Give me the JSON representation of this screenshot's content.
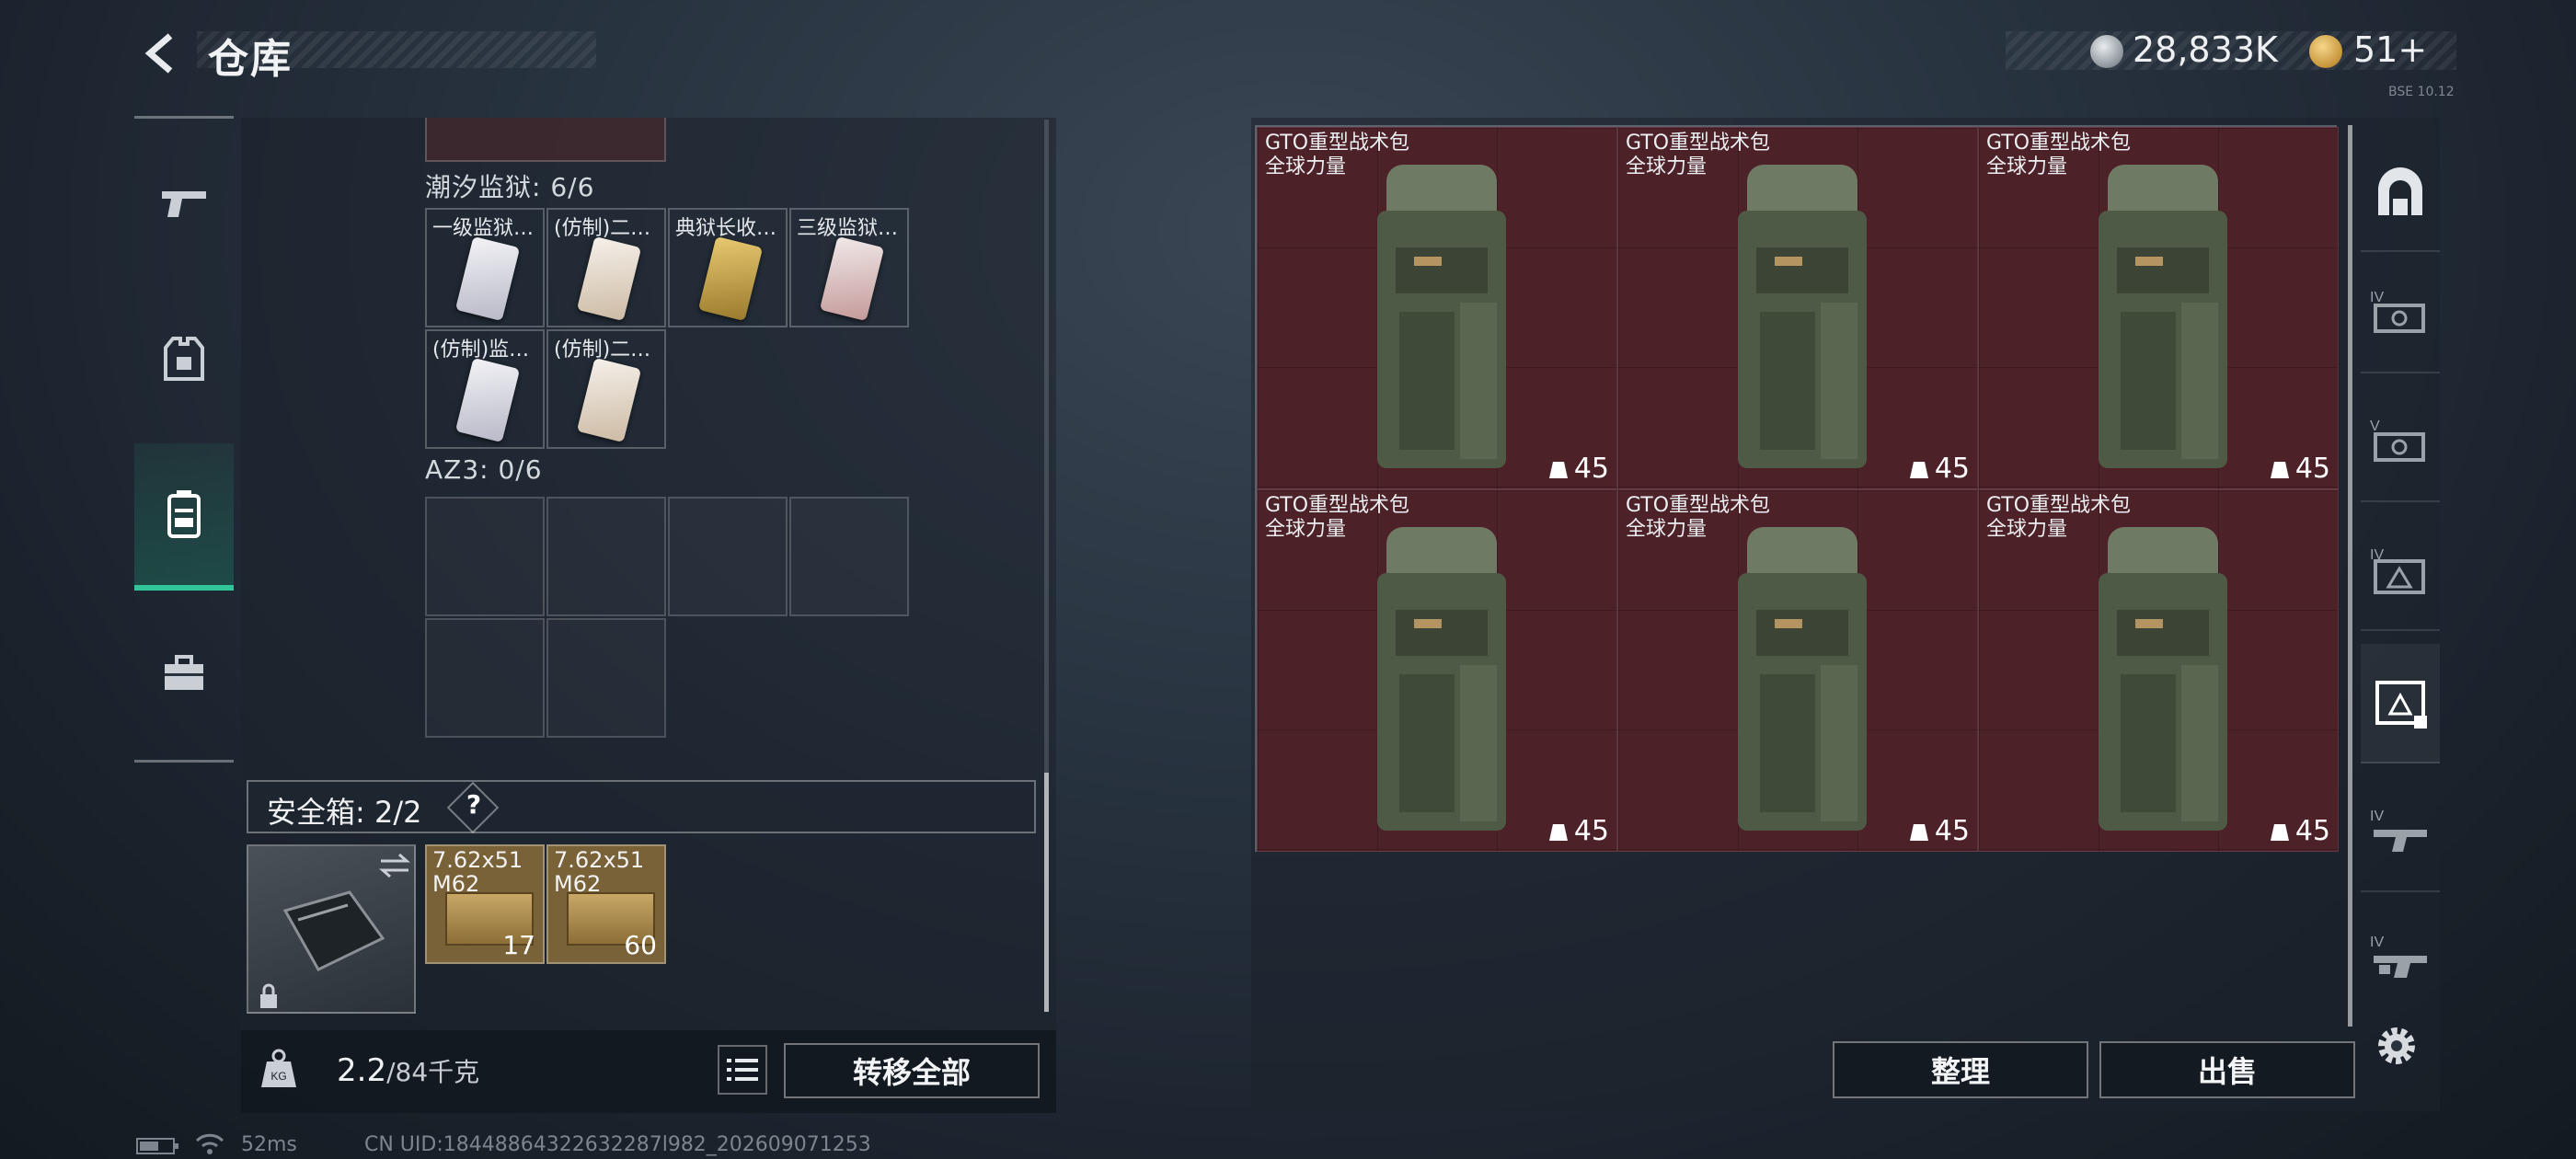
{
  "header": {
    "title": "仓库",
    "currency_silver": "28,833K",
    "currency_gold": "51+",
    "small_label": "BSE 10.12"
  },
  "left_panel": {
    "sections": [
      {
        "label": "潮汐监狱: 6/6",
        "items": [
          {
            "name": "一级监狱…",
            "color": "#3a3d55"
          },
          {
            "name": "(仿制)二…",
            "color": "#5a3e32"
          },
          {
            "name": "典狱长收…",
            "color": "#5b2a2c"
          },
          {
            "name": "三级监狱…",
            "color": "#5b2a2c"
          },
          {
            "name": "(仿制)监…",
            "color": "#3a3d55"
          },
          {
            "name": "(仿制)二…",
            "color": "#5a3e32"
          }
        ]
      },
      {
        "label": "AZ3: 0/6"
      }
    ],
    "safe_box": {
      "label": "安全箱: 2/2",
      "help": "?",
      "ammo": [
        {
          "name": "7.62x51 M62",
          "count": "17"
        },
        {
          "name": "7.62x51 M62",
          "count": "60"
        }
      ]
    },
    "weight": {
      "current": "2.2",
      "max": "/84千克"
    },
    "transfer_all": "转移全部"
  },
  "right_panel": {
    "bags": [
      {
        "name": "GTO重型战术包",
        "brand": "全球力量",
        "count": "45"
      },
      {
        "name": "GTO重型战术包",
        "brand": "全球力量",
        "count": "45"
      },
      {
        "name": "GTO重型战术包",
        "brand": "全球力量",
        "count": "45"
      },
      {
        "name": "GTO重型战术包",
        "brand": "全球力量",
        "count": "45"
      },
      {
        "name": "GTO重型战术包",
        "brand": "全球力量",
        "count": "45"
      },
      {
        "name": "GTO重型战术包",
        "brand": "全球力量",
        "count": "45"
      }
    ],
    "sort_label": "整理",
    "sell_label": "出售"
  },
  "right_tabs": [
    {
      "icon": "arch-icon"
    },
    {
      "icon": "tier-iv-room-icon",
      "tier": "IV"
    },
    {
      "icon": "tier-v-room-icon",
      "tier": "V"
    },
    {
      "icon": "tier-iv-triangle-icon",
      "tier": "IV"
    },
    {
      "icon": "selected-room-icon"
    },
    {
      "icon": "tier-iv-weapon-icon",
      "tier": "IV"
    },
    {
      "icon": "tier-iv-weapon2-icon",
      "tier": "IV"
    }
  ],
  "status_bar": {
    "ping": "52ms",
    "uid": "CN UID:18448864322632287l982_202609071253"
  },
  "colors": {
    "accent": "#33c59a",
    "bag_bg": "#4d2128",
    "ammo_bg": "#7a6238"
  }
}
